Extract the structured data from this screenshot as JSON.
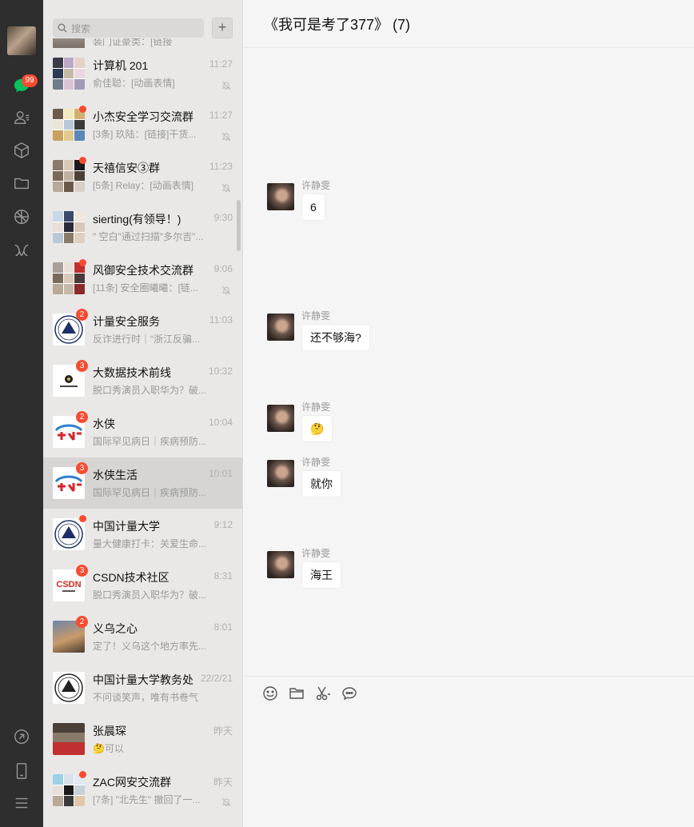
{
  "sidebar": {
    "unread_count": "99",
    "icons": [
      "chat-icon",
      "contacts-icon",
      "favorites-icon",
      "files-icon",
      "moments-icon",
      "miniprogram-icon",
      "link-icon",
      "phone-icon",
      "menu-icon"
    ]
  },
  "search": {
    "placeholder": "搜索"
  },
  "add_label": "+",
  "chats": [
    {
      "name": "计算机 201",
      "msg": "俞佳聪：[动画表情]",
      "time": "11:27",
      "muted": true,
      "badge": "",
      "dot": false
    },
    {
      "name": "小杰安全学习交流群",
      "msg": "[3条] 玖陆：[链接]干货...",
      "time": "11:27",
      "muted": true,
      "badge": "",
      "dot": true
    },
    {
      "name": "天禧信安③群",
      "msg": "[5条] Relay：[动画表情]",
      "time": "11:23",
      "muted": true,
      "badge": "",
      "dot": true
    },
    {
      "name": "sierting(有领导！)",
      "msg": "\" 空白\"通过扫描\"多尔吉\"...",
      "time": "9:30",
      "muted": false,
      "badge": "",
      "dot": false
    },
    {
      "name": "风御安全技术交流群",
      "msg": "[11条] 安全圈曦曦：[链...",
      "time": "9:06",
      "muted": true,
      "badge": "",
      "dot": true
    },
    {
      "name": "计量安全服务",
      "msg": "反诈进行时｜“浙江反骗...",
      "time": "11:03",
      "muted": false,
      "badge": "2",
      "dot": false
    },
    {
      "name": "大数据技术前线",
      "msg": "脱口秀演员入职华为？破...",
      "time": "10:32",
      "muted": false,
      "badge": "3",
      "dot": false
    },
    {
      "name": "水侠",
      "msg": "国际罕见病日｜疾病预防...",
      "time": "10:04",
      "muted": false,
      "badge": "2",
      "dot": false
    },
    {
      "name": "水侠生活",
      "msg": "国际罕见病日｜疾病预防...",
      "time": "10:01",
      "muted": false,
      "badge": "3",
      "dot": false
    },
    {
      "name": "中国计量大学",
      "msg": "量大健康打卡：关爱生命...",
      "time": "9:12",
      "muted": false,
      "badge": "",
      "dot": true
    },
    {
      "name": "CSDN技术社区",
      "msg": "脱口秀演员入职华为？破...",
      "time": "8:31",
      "muted": false,
      "badge": "3",
      "dot": false
    },
    {
      "name": "义乌之心",
      "msg": "定了！义乌这个地方率先...",
      "time": "8:01",
      "muted": false,
      "badge": "2",
      "dot": false
    },
    {
      "name": "中国计量大学教务处",
      "msg": "不问谈笑声，唯有书卷气",
      "time": "22/2/21",
      "muted": false,
      "badge": "",
      "dot": false
    },
    {
      "name": "张晨琛",
      "msg": "🤔可以",
      "time": "昨天",
      "muted": false,
      "badge": "",
      "dot": false
    },
    {
      "name": "ZAC网安交流群",
      "msg": "[7条] \"北先生\" 撤回了一...",
      "time": "昨天",
      "muted": true,
      "badge": "",
      "dot": true
    }
  ],
  "partial_top": {
    "msg": "装门证豪类：[链接"
  },
  "conversation": {
    "title": "《我可是考了377》 (7)",
    "messages": [
      {
        "sender": "许静雯",
        "text": "6"
      },
      {
        "sender": "许静雯",
        "text": "还不够海?"
      },
      {
        "sender": "许静雯",
        "text": "🤔"
      },
      {
        "sender": "许静雯",
        "text": "就你"
      },
      {
        "sender": "许静雯",
        "text": "海王"
      }
    ]
  },
  "toolbar": {
    "icons": [
      "emoji-icon",
      "folder-icon",
      "scissors-icon",
      "chat-bubble-icon"
    ]
  },
  "colors": {
    "badge": "#f74c31",
    "sidebar": "#2e2e2e",
    "list_bg": "#e9e8e7",
    "active": "#d6d5d4"
  }
}
